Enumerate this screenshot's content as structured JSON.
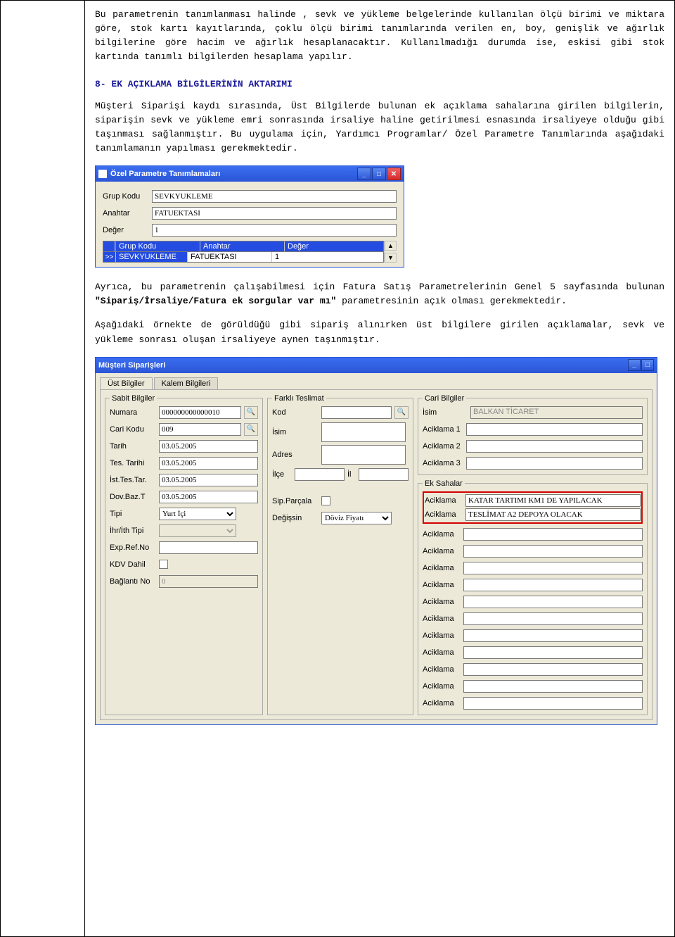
{
  "text": {
    "p1": "Bu parametrenin tanımlanması halinde , sevk ve yükleme belgelerinde kullanılan ölçü birimi ve miktara göre, stok kartı kayıtlarında, çoklu ölçü birimi tanımlarında verilen en, boy, genişlik ve ağırlık bilgilerine göre hacim ve ağırlık hesaplanacaktır. Kullanılmadığı durumda ise, eskisi gibi stok kartında tanımlı bilgilerden hesaplama yapılır.",
    "section8": "8- EK AÇIKLAMA BİLGİLERİNİN AKTARIMI",
    "p2": "Müşteri Siparişi kaydı sırasında, Üst Bilgilerde bulunan ek açıklama sahalarına girilen bilgilerin, siparişin sevk ve yükleme emri sonrasında irsaliye haline getirilmesi esnasında irsaliyeye olduğu gibi taşınması sağlanmıştır. Bu uygulama için, Yardımcı Programlar/ Özel Parametre Tanımlarında aşağıdaki tanımlamanın yapılması gerekmektedir.",
    "p3a": "Ayrıca, bu parametrenin çalışabilmesi için Fatura Satış Parametrelerinin Genel 5 sayfasında bulunan ",
    "p3b": "\"Sipariş/İrsaliye/Fatura ek sorgular var mı\"",
    "p3c": " parametresinin açık olması gerekmektedir.",
    "p4": "Aşağıdaki örnekte de görüldüğü gibi sipariş alınırken üst bilgilere girilen açıklamalar, sevk ve yükleme sonrası oluşan irsaliyeye aynen taşınmıştır."
  },
  "paramWin": {
    "title": "Özel Parametre Tanımlamaları",
    "labels": {
      "grup": "Grup Kodu",
      "anahtar": "Anahtar",
      "deger": "Değer"
    },
    "values": {
      "grup": "SEVKYUKLEME",
      "anahtar": "FATUEKTASI",
      "deger": "1"
    },
    "gridHeaders": {
      "c1": "Grup Kodu",
      "c2": "Anahtar",
      "c3": "Değer"
    },
    "gridRow": {
      "marker": ">>",
      "c1": "SEVKYUKLEME",
      "c2": "FATUEKTASI",
      "c3": "1"
    }
  },
  "orderWin": {
    "title": "Müşteri Siparişleri",
    "tabs": {
      "ust": "Üst Bilgiler",
      "kalem": "Kalem Bilgileri"
    },
    "sabit": {
      "legend": "Sabit Bilgiler",
      "numara_l": "Numara",
      "numara_v": "000000000000010",
      "cari_l": "Cari Kodu",
      "cari_v": "009",
      "tarih_l": "Tarih",
      "tarih_v": "03.05.2005",
      "testar_l": "Tes. Tarihi",
      "testar_v": "03.05.2005",
      "isttar_l": "İst.Tes.Tar.",
      "isttar_v": "03.05.2005",
      "dovbaz_l": "Dov.Baz.T",
      "dovbaz_v": "03.05.2005",
      "tipi_l": "Tipi",
      "tipi_v": "Yurt İçi",
      "ihr_l": "İhr/İth Tipi",
      "exp_l": "Exp.Ref.No",
      "kdv_l": "KDV Dahil",
      "bag_l": "Bağlantı No",
      "bag_v": "0"
    },
    "teslimat": {
      "legend": "Farklı Teslimat",
      "kod_l": "Kod",
      "isim_l": "İsim",
      "adres_l": "Adres",
      "ilce_l": "İlçe",
      "il_l": "İl",
      "sip_l": "Sip.Parçala",
      "deg_l": "Değişsin",
      "deg_v": "Döviz Fiyatı"
    },
    "cari": {
      "legend": "Cari Bilgiler",
      "isim_l": "İsim",
      "isim_v": "BALKAN TİCARET",
      "ac1_l": "Aciklama 1",
      "ac2_l": "Aciklama 2",
      "ac3_l": "Aciklama 3"
    },
    "ek": {
      "legend": "Ek Sahalar",
      "label": "Aciklama",
      "v1": "KATAR TARTIMI KM1 DE YAPILACAK",
      "v2": "TESLİMAT A2 DEPOYA OLACAK"
    }
  }
}
